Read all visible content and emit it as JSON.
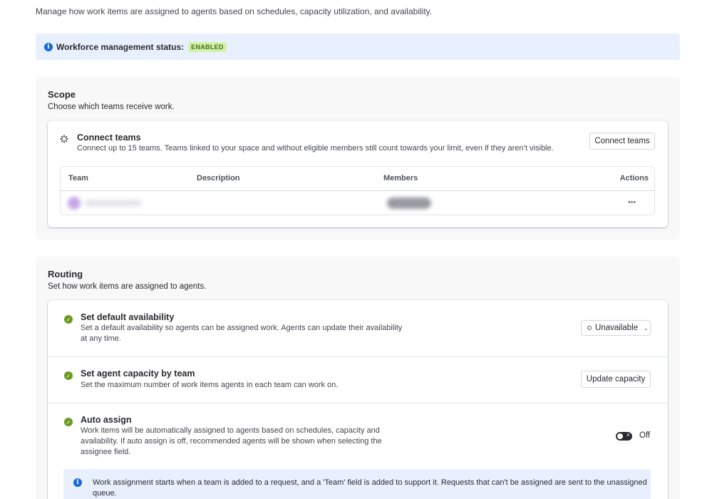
{
  "intro": "Manage how work items are assigned to agents based on schedules, capacity utilization, and availability.",
  "status": {
    "label": "Workforce management status:",
    "badge": "ENABLED"
  },
  "scope": {
    "title": "Scope",
    "subtitle": "Choose which teams receive work.",
    "connect": {
      "title": "Connect teams",
      "description": "Connect up to 15 teams. Teams linked to your space and without eligible members still count towards your limit, even if they aren’t visible.",
      "button": "Connect teams"
    },
    "table": {
      "columns": [
        "Team",
        "Description",
        "Members",
        "Actions"
      ],
      "rows": [
        {
          "actions_icon": "more-icon",
          "actions_glyph": "···"
        }
      ]
    }
  },
  "routing": {
    "title": "Routing",
    "subtitle": "Set how work items are assigned to agents.",
    "default_availability": {
      "title": "Set default availability",
      "description_line1": "Set a default availability so agents can be assigned work. Agents can update their availability",
      "description_line2": "at any time.",
      "select_value": "Unavailable"
    },
    "capacity": {
      "title": "Set agent capacity by team",
      "description": "Set the maximum number of work items agents in each team can work on.",
      "button": "Update capacity"
    },
    "auto_assign": {
      "title": "Auto assign",
      "description_line1": "Work items will be automatically assigned to agents based on schedules, capacity and",
      "description_line2": "availability. If auto assign is off, recommended agents will be shown when selecting the",
      "description_line3": "assignee field.",
      "toggle_state": "Off"
    },
    "note": {
      "line1": "Work assignment starts when a team is added to a request, and a 'Team' field is added to support it. Requests that can't be assigned are sent to the unassigned",
      "line2": "queue."
    }
  },
  "colors": {
    "info": "#1868db",
    "success": "#6a9a23",
    "badge_bg": "#d3f1a7",
    "banner_bg": "#e9f0fd"
  }
}
